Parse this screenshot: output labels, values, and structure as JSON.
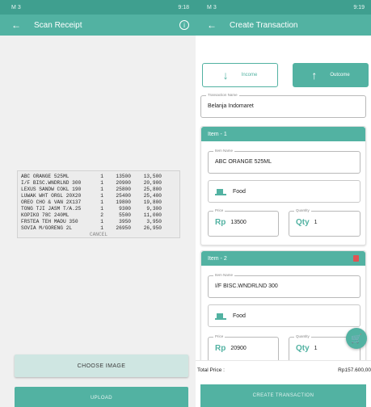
{
  "status_bar": {
    "left": {
      "carrier": "M3",
      "time": "9:18"
    },
    "right": {
      "carrier": "M3",
      "time": "9:19"
    }
  },
  "scan_receipt": {
    "title": "Scan Receipt",
    "icons": {
      "back": "back-arrow-icon",
      "info": "info-icon"
    },
    "receipt_lines": [
      {
        "name": "ABC ORANGE 525ML",
        "qty": "1",
        "price": "13500",
        "total": "13,500"
      },
      {
        "name": "I/F BISC.WNDRLND 300",
        "qty": "1",
        "price": "20900",
        "total": "20,900"
      },
      {
        "name": "LEXUS SANDW COKL 190",
        "qty": "1",
        "price": "25800",
        "total": "25,800"
      },
      {
        "name": "LUWAK WHT ORGL 20X20",
        "qty": "1",
        "price": "25400",
        "total": "25,400"
      },
      {
        "name": "OREO CHO & VAN 2X137",
        "qty": "1",
        "price": "19800",
        "total": "19,800"
      },
      {
        "name": "TONG TJI JASM T/A.25",
        "qty": "1",
        "price": "9300",
        "total": "9,300"
      },
      {
        "name": "KOPIKO 78C 240ML",
        "qty": "2",
        "price": "5500",
        "total": "11,000"
      },
      {
        "name": "FRSTEA TEH MADU 350",
        "qty": "1",
        "price": "3950",
        "total": "3,950"
      },
      {
        "name": "SOVIA M/GORENG 2L",
        "qty": "1",
        "price": "26950",
        "total": "26,950"
      }
    ],
    "receipt_cut": "CANCEL",
    "choose_image_label": "CHOOSE IMAGE",
    "upload_label": "UPLOAD"
  },
  "create_transaction": {
    "title": "Create Transaction",
    "income_label": "Income",
    "outcome_label": "Outcome",
    "transaction_name": {
      "legend": "Transaction Name",
      "value": "Belanja Indomaret"
    },
    "items": [
      {
        "header": "Item - 1",
        "name_legend": "Item Name",
        "name": "ABC ORANGE 525ML",
        "category": "Food",
        "price_legend": "Price",
        "price_prefix": "Rp",
        "price": "13500",
        "qty_legend": "Quantity",
        "qty_prefix": "Qty",
        "qty": "1"
      },
      {
        "header": "Item - 2",
        "name_legend": "Item Name",
        "name": "I/F BISC.WNDRLND 300",
        "category": "Food",
        "price_legend": "Price",
        "price_prefix": "Rp",
        "price": "20900",
        "qty_legend": "Quantity",
        "qty_prefix": "Qty",
        "qty": "1"
      }
    ],
    "total_label": "Total Price :",
    "total_value": "Rp157.600,00",
    "create_label": "CREATE TRANSACTION"
  },
  "colors": {
    "primary": "#52b2a2",
    "status_bar": "#3f9f8f",
    "delete": "#e05353"
  }
}
